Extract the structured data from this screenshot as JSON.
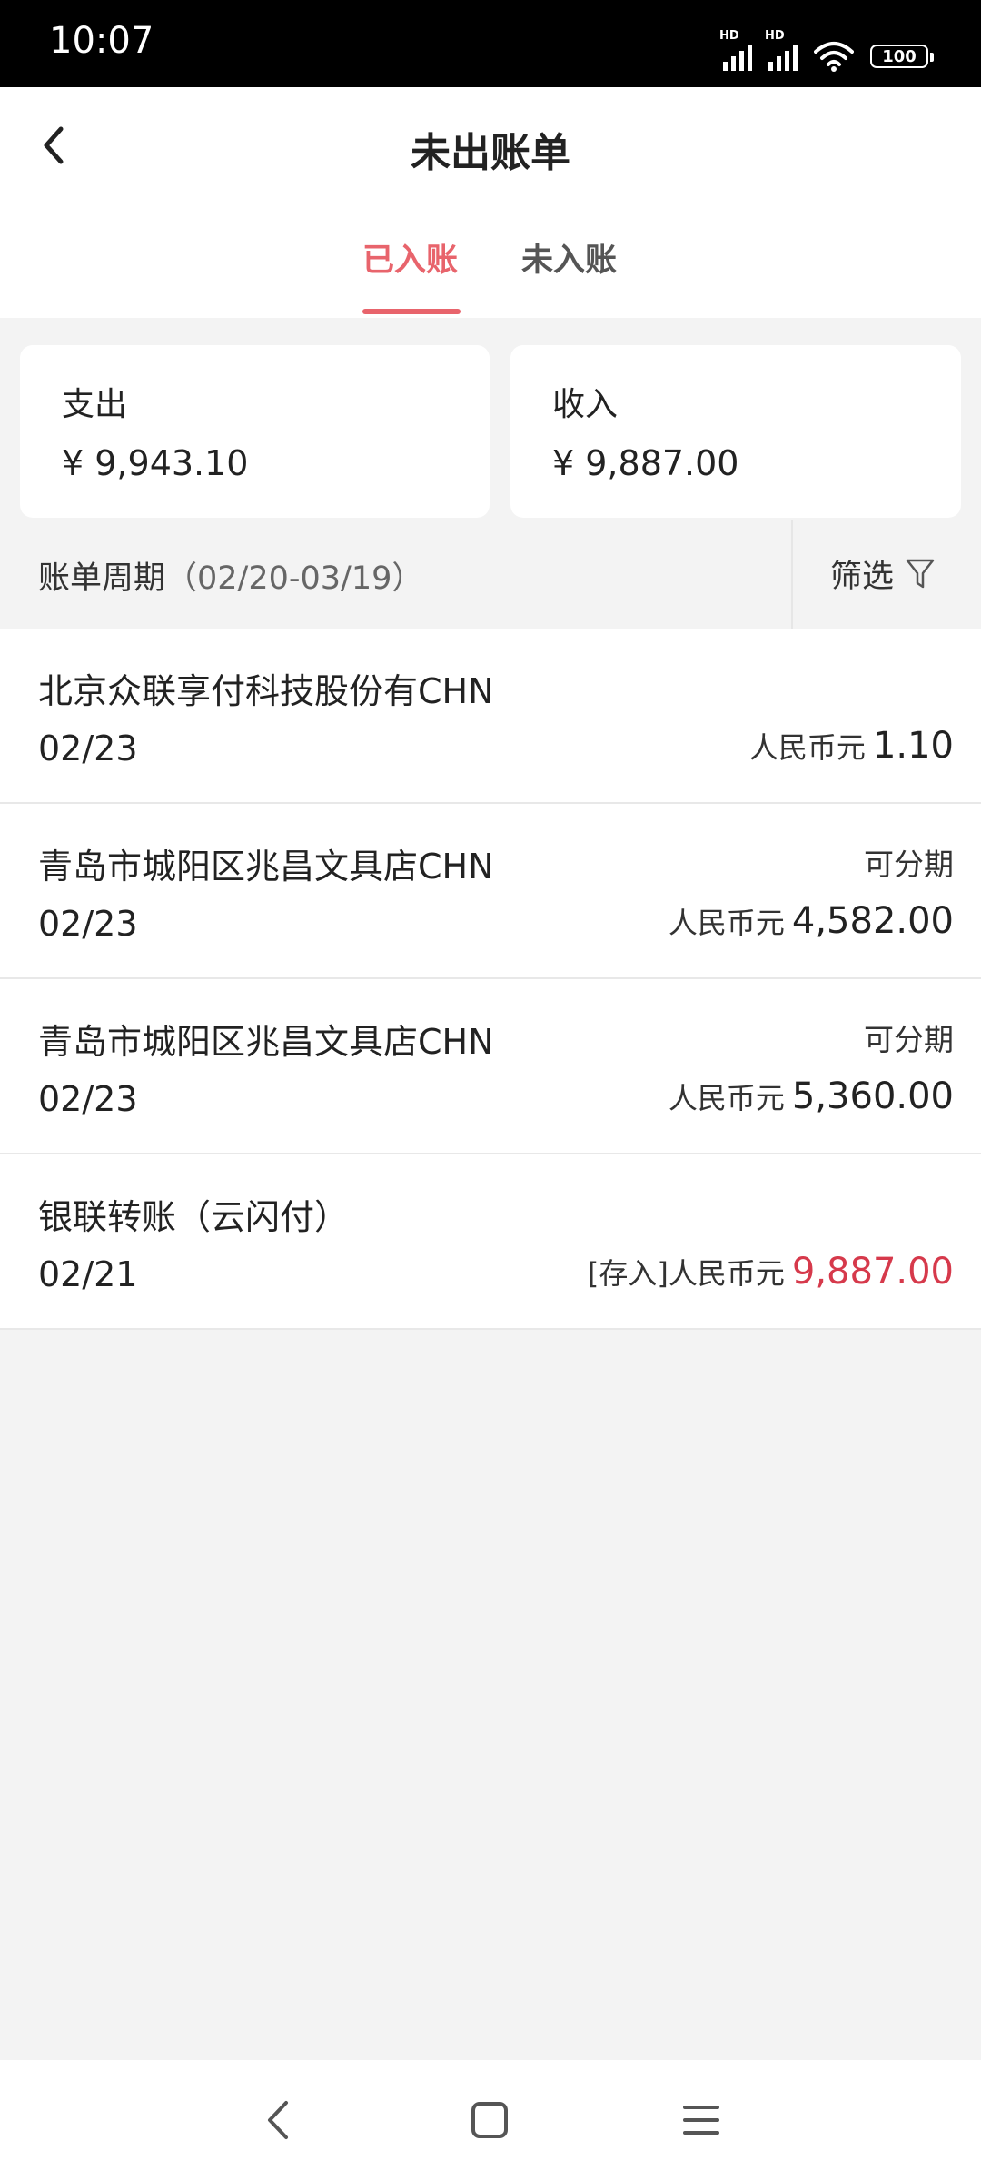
{
  "status": {
    "time": "10:07",
    "signal_label": "HD",
    "battery": "100"
  },
  "header": {
    "title": "未出账单"
  },
  "tabs": [
    {
      "label": "已入账",
      "active": true
    },
    {
      "label": "未入账",
      "active": false
    }
  ],
  "summary": {
    "expense": {
      "label": "支出",
      "amount": "¥ 9,943.10"
    },
    "income": {
      "label": "收入",
      "amount": "¥ 9,887.00"
    }
  },
  "period": {
    "label": "账单周期",
    "range": "（02/20-03/19）",
    "filter_label": "筛选"
  },
  "transactions": [
    {
      "merchant": "北京众联享付科技股份有CHN",
      "date": "02/23",
      "tag": "",
      "currency": "人民币元",
      "amount": "1.10",
      "type": "debit"
    },
    {
      "merchant": "青岛市城阳区兆昌文具店CHN",
      "date": "02/23",
      "tag": "可分期",
      "currency": "人民币元",
      "amount": "4,582.00",
      "type": "debit"
    },
    {
      "merchant": "青岛市城阳区兆昌文具店CHN",
      "date": "02/23",
      "tag": "可分期",
      "currency": "人民币元",
      "amount": "5,360.00",
      "type": "debit"
    },
    {
      "merchant": "银联转账（云闪付）",
      "date": "02/21",
      "tag": "",
      "currency": "[存入]人民币元",
      "amount": "9,887.00",
      "type": "credit"
    }
  ],
  "colors": {
    "accent": "#e8646c",
    "credit": "#d6394b"
  },
  "icons": [
    "back-icon",
    "filter-icon",
    "wifi-icon",
    "signal-icon",
    "battery-icon",
    "nav-back-icon",
    "nav-home-icon",
    "nav-menu-icon"
  ]
}
